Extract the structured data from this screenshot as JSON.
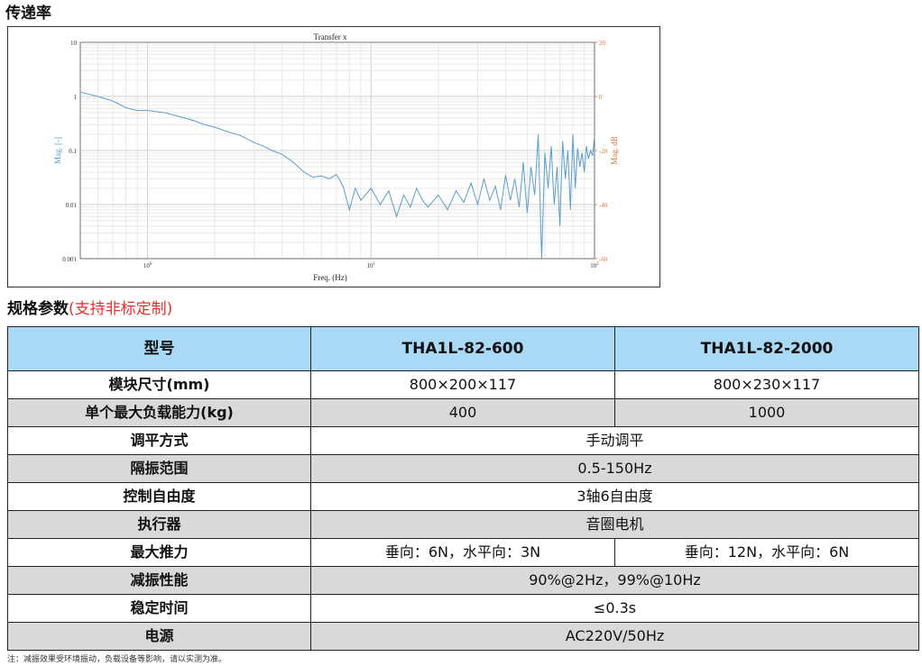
{
  "headings": {
    "transfer": "传递率",
    "spec_main": "规格参数",
    "spec_note": "(支持非标定制)"
  },
  "chart_data": {
    "type": "line",
    "title": "Transfer x",
    "xlabel": "Freq. (Hz)",
    "ylabel": "Mag. [-]",
    "ylabel_right": "Mag. dB",
    "x_scale": "log",
    "y_scale": "log",
    "xlim": [
      0.5,
      100
    ],
    "ylim": [
      0.001,
      10
    ],
    "ylim_right": [
      -60,
      20
    ],
    "x_ticks": [
      "10^0",
      "10^1",
      "10^2"
    ],
    "y_ticks": [
      "10",
      "1",
      "0.1",
      "0.01",
      "0.001"
    ],
    "y_ticks_right": [
      "20",
      "0",
      "-20",
      "-40",
      "-60"
    ],
    "grid": true,
    "line_color": "#5b9ec9",
    "right_axis_color": "#d9703a",
    "x": [
      0.5,
      0.6,
      0.7,
      0.8,
      0.9,
      1.0,
      1.2,
      1.4,
      1.6,
      1.8,
      2.0,
      2.3,
      2.6,
      3.0,
      3.3,
      3.6,
      4.0,
      4.5,
      5.0,
      5.5,
      6.0,
      6.5,
      7.0,
      7.5,
      8.0,
      8.5,
      9.0,
      10,
      11,
      12,
      13,
      14,
      15,
      16,
      17,
      18,
      20,
      22,
      24,
      26,
      28,
      30,
      32,
      34,
      36,
      38,
      40,
      42,
      44,
      46,
      48,
      50,
      52,
      54,
      56,
      58,
      60,
      62,
      64,
      66,
      68,
      70,
      72,
      74,
      76,
      78,
      80,
      82,
      84,
      86,
      88,
      90,
      92,
      94,
      96,
      98,
      100
    ],
    "y": [
      1.2,
      1.0,
      0.82,
      0.62,
      0.55,
      0.55,
      0.5,
      0.42,
      0.36,
      0.3,
      0.27,
      0.22,
      0.19,
      0.14,
      0.12,
      0.1,
      0.085,
      0.06,
      0.04,
      0.032,
      0.034,
      0.03,
      0.036,
      0.022,
      0.008,
      0.02,
      0.012,
      0.02,
      0.01,
      0.018,
      0.006,
      0.015,
      0.009,
      0.02,
      0.012,
      0.009,
      0.015,
      0.008,
      0.018,
      0.011,
      0.025,
      0.01,
      0.03,
      0.012,
      0.022,
      0.008,
      0.035,
      0.012,
      0.03,
      0.009,
      0.06,
      0.007,
      0.05,
      0.015,
      0.2,
      0.001,
      0.09,
      0.02,
      0.12,
      0.01,
      0.05,
      0.004,
      0.15,
      0.03,
      0.1,
      0.008,
      0.2,
      0.02,
      0.11,
      0.05,
      0.09,
      0.04,
      0.12,
      0.07,
      0.1,
      0.08,
      0.18
    ]
  },
  "table": {
    "header": [
      "型号",
      "THA1L-82-600",
      "THA1L-82-2000"
    ],
    "rows": [
      {
        "label": "模块尺寸(mm)",
        "values": [
          "800×200×117",
          "800×230×117"
        ]
      },
      {
        "label": "单个最大负载能力(kg)",
        "values": [
          "400",
          "1000"
        ]
      },
      {
        "label": "调平方式",
        "values": [
          "手动调平"
        ]
      },
      {
        "label": "隔振范围",
        "values": [
          "0.5-150Hz"
        ]
      },
      {
        "label": "控制自由度",
        "values": [
          "3轴6自由度"
        ]
      },
      {
        "label": "执行器",
        "values": [
          "音圈电机"
        ]
      },
      {
        "label": "最大推力",
        "values": [
          "垂向：6N，水平向：3N",
          "垂向：12N，水平向：6N"
        ]
      },
      {
        "label": "减振性能",
        "values": [
          "90%@2Hz，99%@10Hz"
        ]
      },
      {
        "label": "稳定时间",
        "values": [
          "≤0.3s"
        ]
      },
      {
        "label": "电源",
        "values": [
          "AC220V/50Hz"
        ]
      }
    ]
  },
  "note": "注：减振效果受环境振动，负载设备等影响，请以实测为准。"
}
